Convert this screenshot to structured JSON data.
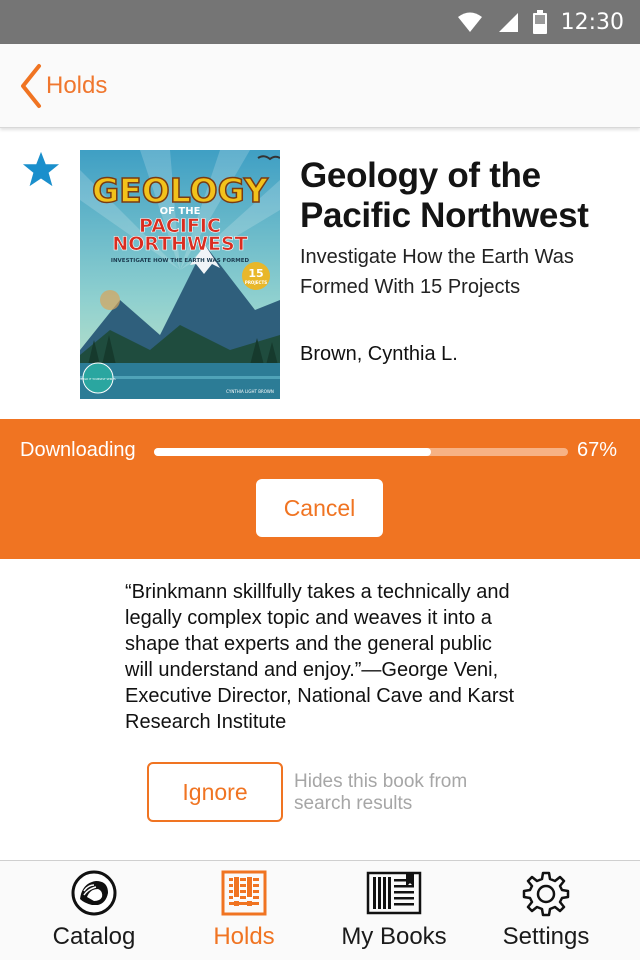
{
  "status_bar": {
    "time": "12:30",
    "icons": [
      "wifi-icon",
      "signal-icon",
      "battery-icon"
    ]
  },
  "nav": {
    "back_label": "Holds",
    "accent_color": "#f07422"
  },
  "book": {
    "title": "Geology of the Pacific Northwest",
    "subtitle": "Investigate How the Earth Was Formed With 15 Projects",
    "author": "Brown, Cynthia L.",
    "starred": true,
    "cover": {
      "title_line1": "GEOLOGY",
      "title_line2": "OF THE",
      "title_line3": "PACIFIC",
      "title_line4": "NORTHWEST",
      "tagline": "INVESTIGATE HOW THE EARTH WAS FORMED",
      "badge_number": "15",
      "badge_text": "PROJECTS",
      "series": "BUILD IT YOURSELF SERIES",
      "cover_author": "CYNTHIA LIGHT BROWN"
    }
  },
  "download": {
    "label": "Downloading",
    "progress": 0.67,
    "percent_text": "67%",
    "cancel_label": "Cancel",
    "band_color": "#f07422"
  },
  "review": {
    "text": "“Brinkmann skillfully takes a technically and legally complex topic and weaves it into a shape that experts and the general public will understand and enjoy.”—George Veni, Executive Director, National Cave and Karst Research Institute"
  },
  "ignore": {
    "button_label": "Ignore",
    "hint": "Hides this book from search results"
  },
  "tabs": [
    {
      "label": "Catalog",
      "icon": "lion-icon",
      "active": false
    },
    {
      "label": "Holds",
      "icon": "holds-icon",
      "active": true
    },
    {
      "label": "My Books",
      "icon": "books-icon",
      "active": false
    },
    {
      "label": "Settings",
      "icon": "gear-icon",
      "active": false
    }
  ]
}
